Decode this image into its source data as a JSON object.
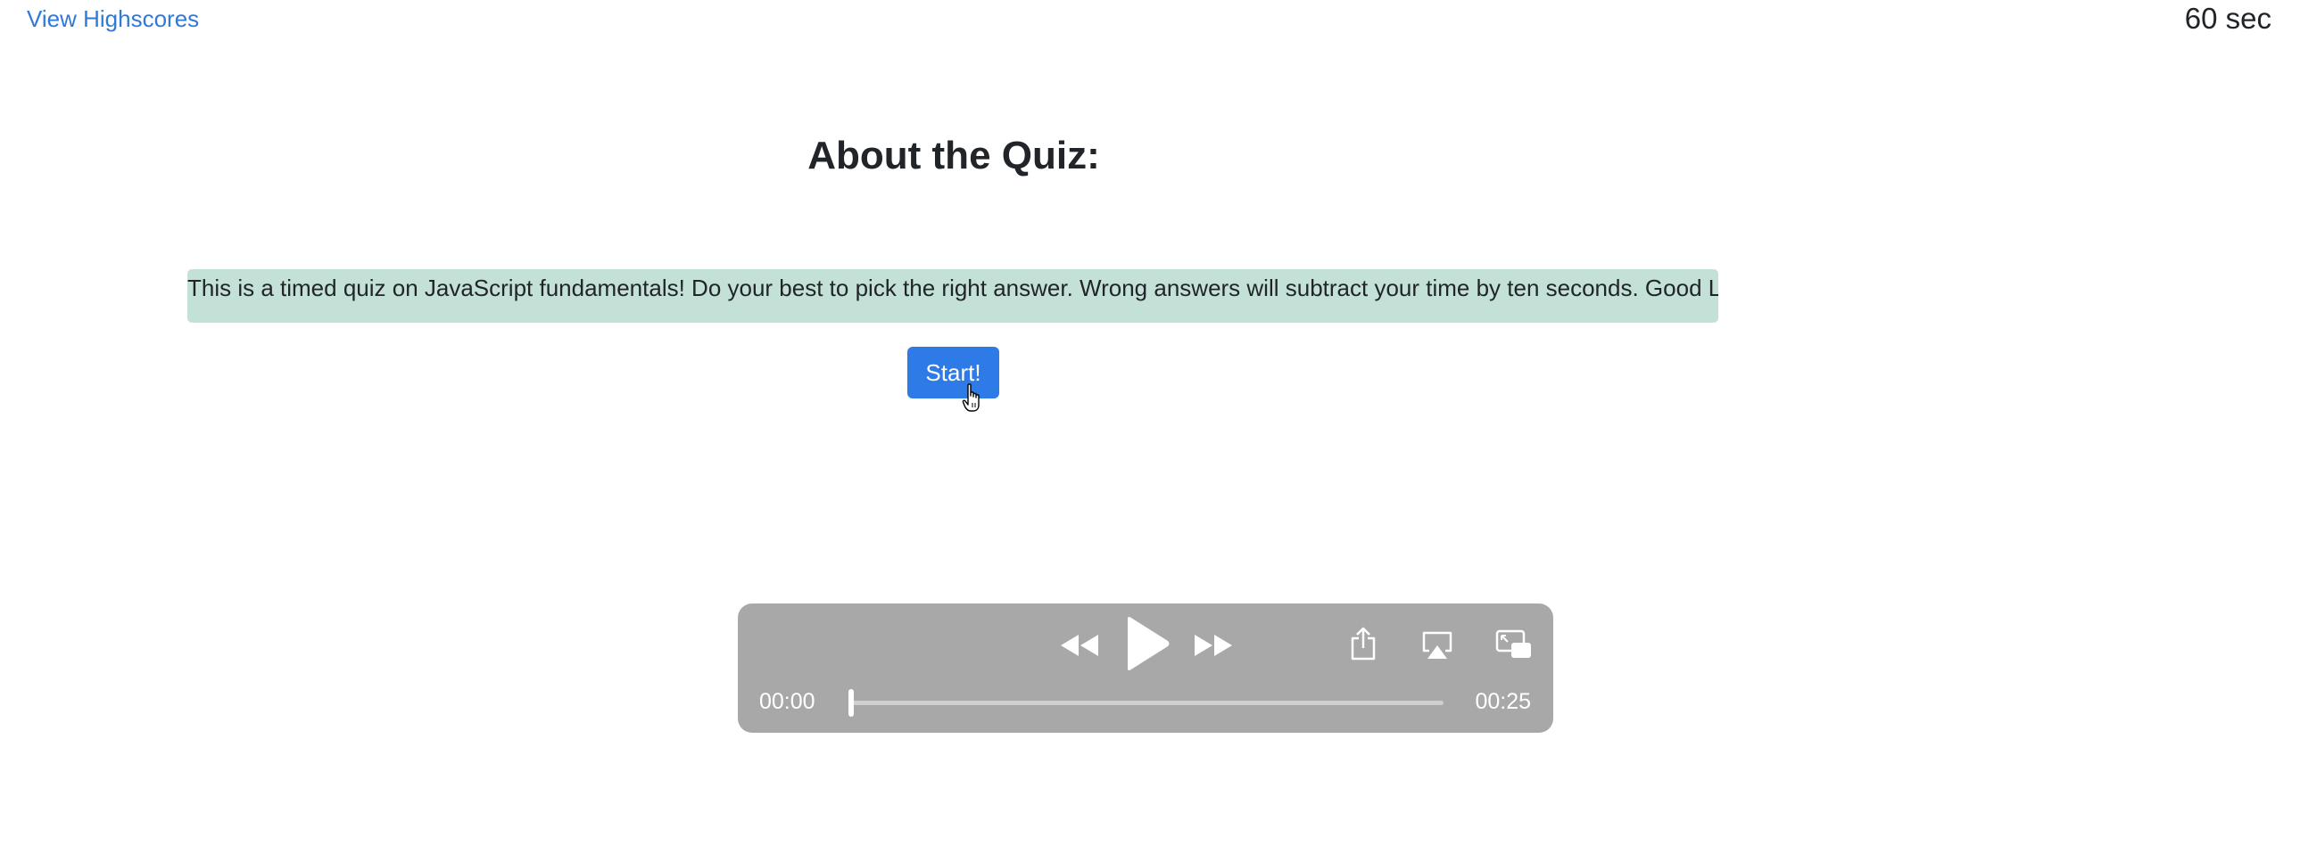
{
  "header": {
    "highscores_link": "View Highscores",
    "timer": "60 sec"
  },
  "main": {
    "title": "About the Quiz:",
    "description": "This is a timed quiz on JavaScript fundamentals! Do your best to pick the right answer. Wrong answers will subtract your time by ten seconds. Good Luck!",
    "start_label": "Start!"
  },
  "player": {
    "current_time": "00:00",
    "duration": "00:25",
    "progress": 0,
    "icons": [
      "rewind-icon",
      "play-icon",
      "fast-forward-icon",
      "share-icon",
      "airplay-icon",
      "picture-in-picture-icon"
    ]
  },
  "colors": {
    "link": "#2f7ad8",
    "description_bg": "#c4e1d7",
    "button_bg": "#2e7ae6",
    "player_bg": "#a8a8a8"
  }
}
